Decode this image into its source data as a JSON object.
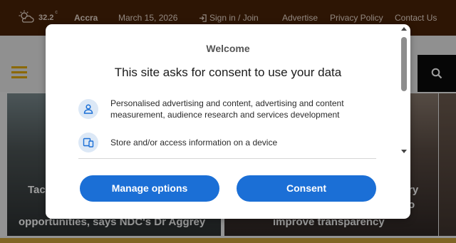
{
  "topbar": {
    "weather_icon": "partly-cloudy-icon",
    "temperature": "32.2",
    "degree_unit": "c",
    "city": "Accra",
    "date": "March 15, 2026",
    "signin_label": "Sign in / Join",
    "links": [
      "Advertise",
      "Privacy Policy",
      "Contact Us"
    ]
  },
  "navbar": {
    "menu_icon": "hamburger-menu-icon",
    "search_icon": "search-icon",
    "accent_color": "#e0a800"
  },
  "articles": [
    {
      "line1": "Tac",
      "line2": "opportunities, says NDC's Dr Aggrey"
    },
    {
      "line1": "ry",
      "line1b": "o",
      "line2": "improve transparency"
    }
  ],
  "dialog": {
    "welcome": "Welcome",
    "headline": "This site asks for consent to use your data",
    "purposes": [
      {
        "icon": "person-icon",
        "text": "Personalised advertising and content, advertising and content measurement, audience research and services development"
      },
      {
        "icon": "devices-icon",
        "text": "Store and/or access information on a device"
      }
    ],
    "buttons": {
      "manage": "Manage options",
      "consent": "Consent"
    },
    "button_color": "#1b6fd6"
  }
}
